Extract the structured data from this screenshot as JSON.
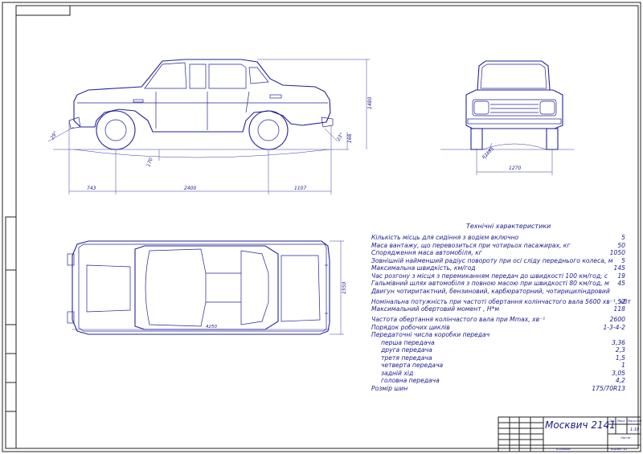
{
  "dimensions": {
    "front_overhang": "743",
    "wheelbase": "2400",
    "rear_overhang": "1107",
    "height": "1480",
    "ground_clearance_rear": "168",
    "ground_clearance_under": "170",
    "approach_angle": "29°",
    "departure_angle": "23°",
    "track": "1270",
    "front_clearance": "R1185",
    "width": "1550",
    "top_length": "4250"
  },
  "spec": {
    "title": "Технічні характеристики",
    "rows": [
      {
        "label": "Кількість місць для сидіння з водієм включно",
        "value": "5",
        "indent": false
      },
      {
        "label": "Маса вантажу, що перевозиться при чотирьох пасажирах, кг",
        "value": "50",
        "indent": false
      },
      {
        "label": "Спорядження маса автомобіля, кг",
        "value": "1050",
        "indent": false
      },
      {
        "label": "Зовнішній найменший радіус повороту при осі сліду переднього колеса, м",
        "value": "5",
        "indent": false
      },
      {
        "label": "Максимальна швидкість, км/год",
        "value": "145",
        "indent": false
      },
      {
        "label": "Час розгону з місця з перемиканням передач до швидкості 100 км/год, с",
        "value": "19",
        "indent": false
      },
      {
        "label": "Гальмівний шлях автомобіля з повною масою при швидкості 80 км/год, м",
        "value": "45",
        "indent": false
      },
      {
        "label": "Двигун чотиритактний, бензиновий, карбюраторний, чотирициліндровий",
        "value": "",
        "indent": false
      },
      {
        "label": "Номінальна потужність при частоті обертання колінчастого вала 5600 хв⁻¹, кВт",
        "value": "52",
        "indent": false
      },
      {
        "label": "Максимальний обертовий момент , Н*м",
        "value": "118",
        "indent": false
      },
      {
        "label": "Частота обертання колінчастого вала при Mmax, хв⁻¹",
        "value": "2600",
        "indent": false
      },
      {
        "label": "Порядок робочих циклів",
        "value": "1-3-4-2",
        "indent": false
      },
      {
        "label": "Передаточні числа коробки передач",
        "value": "",
        "indent": false
      },
      {
        "label": "перша передача",
        "value": "3,36",
        "indent": true
      },
      {
        "label": "друга передача",
        "value": "2,3",
        "indent": true
      },
      {
        "label": "третя передача",
        "value": "1,5",
        "indent": true
      },
      {
        "label": "четверта передача",
        "value": "1",
        "indent": true
      },
      {
        "label": "задній хід",
        "value": "3,05",
        "indent": true
      },
      {
        "label": "головна передача",
        "value": "4,2",
        "indent": true
      },
      {
        "label": "Розмір шин",
        "value": "175/70R13",
        "indent": false
      }
    ]
  },
  "title_block": {
    "name": "Москвич 2141",
    "sheet_label": "Лист",
    "mass_label": "Маса",
    "scale_label": "Масштаб",
    "scale": "1:10",
    "sheets_label": "Листів",
    "format": "Формат А1",
    "copied": "Копіював"
  }
}
